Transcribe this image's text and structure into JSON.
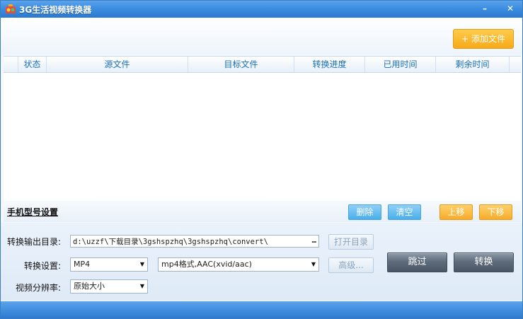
{
  "window": {
    "title": "3G生活视频转换器",
    "minimize_glyph": "–",
    "close_glyph": "✕",
    "icons": {
      "app": "app-logo-icon",
      "minimize": "minimize-icon",
      "close": "close-icon"
    }
  },
  "toolbar": {
    "add_file_icon": "+",
    "add_file_label": "添加文件"
  },
  "table": {
    "columns": [
      "状态",
      "源文件",
      "目标文件",
      "转换进度",
      "已用时间",
      "剩余时间"
    ],
    "rows": []
  },
  "device": {
    "label": "手机型号设置",
    "delete_label": "删除",
    "clear_label": "清空",
    "move_up_label": "上移",
    "move_down_label": "下移"
  },
  "settings": {
    "output_dir_label": "转换输出目录:",
    "output_dir_value": "d:\\uzzf\\下载目录\\3gshspzhq\\3gshspzhq\\convert\\",
    "browse_glyph": "…",
    "open_dir_label": "打开目录",
    "convert_settings_label": "转换设置:",
    "format_value": "MP4",
    "codec_value": "mp4格式,AAC(xvid/aac)",
    "advanced_label": "高级...",
    "resolution_label": "视频分辨率:",
    "resolution_value": "原始大小",
    "skip_label": "跳过",
    "convert_label": "转换"
  },
  "colors": {
    "titlebar": "#3d8ee1",
    "header_text": "#1a6fb4",
    "blue_button": "#49aee9",
    "orange_button": "#f6ac2a",
    "dark_button": "#5f6c7b"
  }
}
